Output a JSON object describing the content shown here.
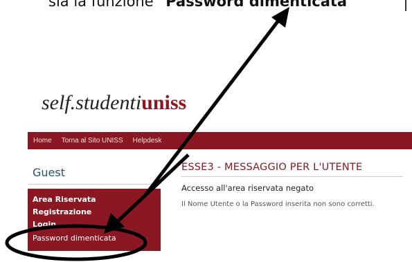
{
  "caption": {
    "text_prefix": "sia la funzione “",
    "text_bold": "Password dimenticata",
    "text_suffix": "”"
  },
  "logo": {
    "text_plain": "self.studenti",
    "text_brand": "uniss"
  },
  "navbar": {
    "items": [
      "Home",
      "Torna al Sito UNISS",
      "Helpdesk"
    ]
  },
  "sidebar": {
    "title": "Guest",
    "items": [
      "Area Riservata",
      "Registrazione",
      "Login",
      "Password dimenticata"
    ]
  },
  "message": {
    "title": "ESSE3 - MESSAGGIO PER L'UTENTE",
    "subtitle": "Accesso all'area riservata negato",
    "body": "Il Nome Utente o la Password inserita non sono corretti."
  },
  "colors": {
    "brand": "#8b1723",
    "annotation": "#000000"
  }
}
